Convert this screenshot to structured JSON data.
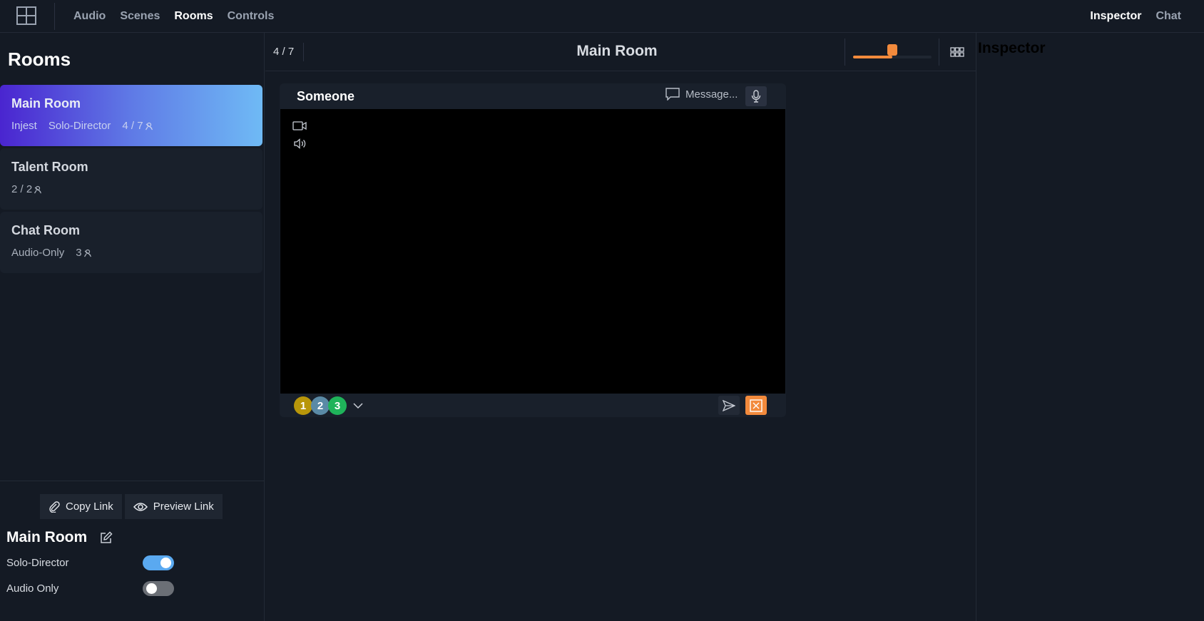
{
  "topbar": {
    "logo_icon": "layout-grid-icon",
    "nav": [
      "Audio",
      "Scenes",
      "Rooms",
      "Controls"
    ],
    "nav_active": "Rooms",
    "right_nav": [
      "Inspector",
      "Chat"
    ],
    "right_active": "Inspector"
  },
  "sidebar": {
    "title": "Rooms",
    "rooms": [
      {
        "name": "Main Room",
        "tags": [
          "Injest",
          "Solo-Director"
        ],
        "count": "4 / 7",
        "active": true
      },
      {
        "name": "Talent Room",
        "tags": [],
        "count": "2 / 2",
        "active": false
      },
      {
        "name": "Chat Room",
        "tags": [
          "Audio-Only"
        ],
        "count": "3",
        "active": false
      }
    ],
    "copy_link": "Copy Link",
    "preview_link": "Preview Link",
    "selected_room": "Main Room",
    "settings": [
      {
        "label": "Solo-Director",
        "on": true
      },
      {
        "label": "Audio Only",
        "on": false
      }
    ]
  },
  "center": {
    "count": "4 / 7",
    "room_title": "Main Room",
    "volume_level": 0.5,
    "panel": {
      "name": "Someone",
      "message_placeholder": "Message...",
      "badges": [
        {
          "label": "1",
          "color": "#b8960a"
        },
        {
          "label": "2",
          "color": "#5a8aa6"
        },
        {
          "label": "3",
          "color": "#1fb35a"
        }
      ]
    }
  },
  "inspector": {
    "title": "Inspector"
  },
  "colors": {
    "accent_orange": "#f28a3c",
    "toggle_on": "#5aa9f0",
    "active_gradient_start": "#4a25d0",
    "active_gradient_end": "#6fbaf5"
  }
}
